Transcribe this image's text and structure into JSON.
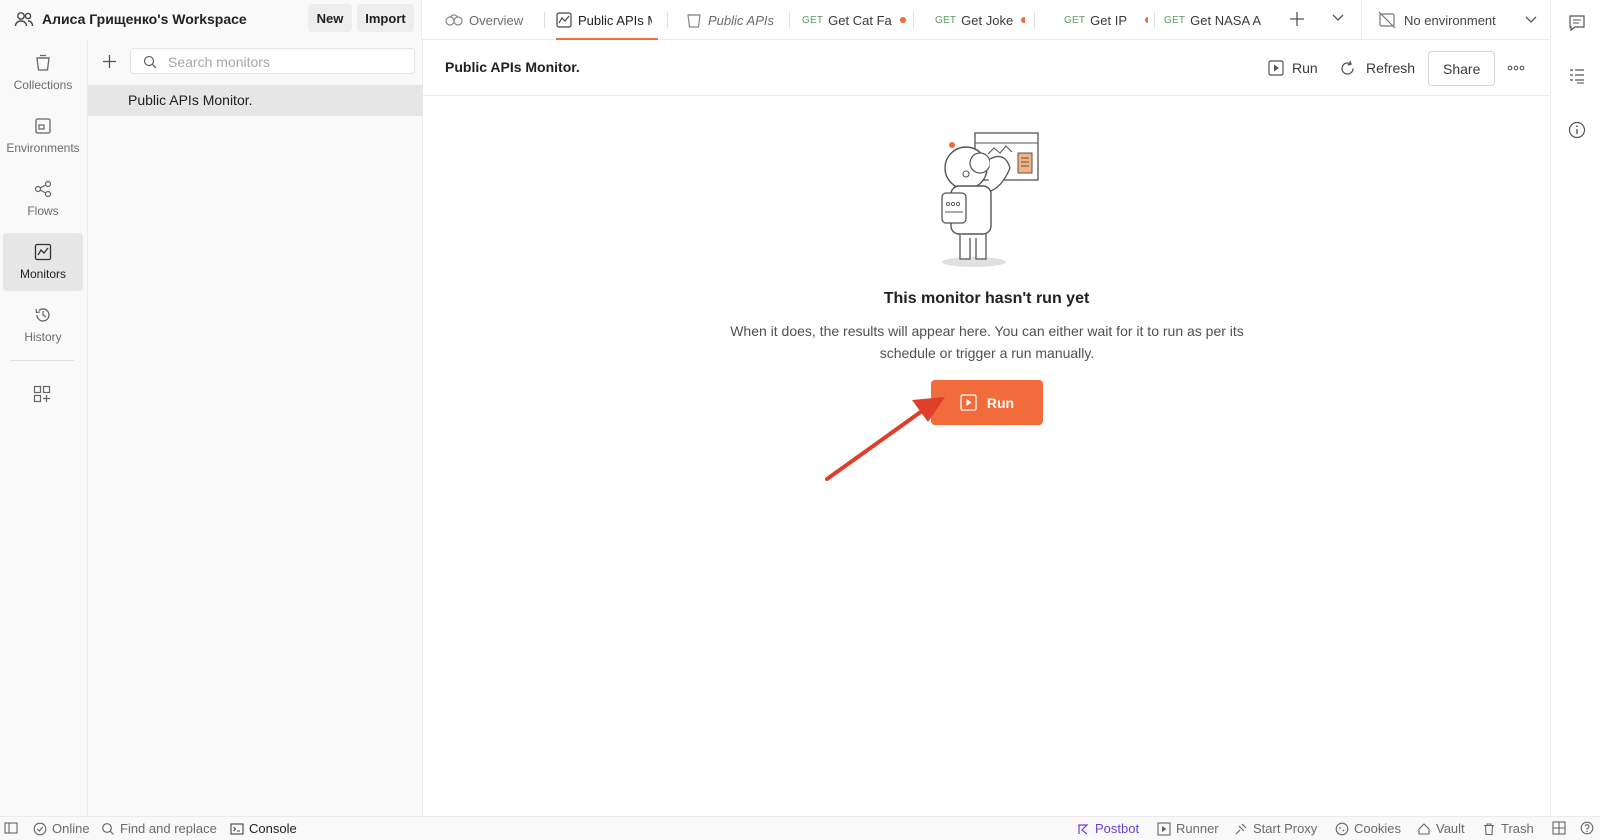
{
  "workspace": {
    "name": "Алиса Грищенко's Workspace",
    "new_label": "New",
    "import_label": "Import"
  },
  "tabs": [
    {
      "label": "Overview"
    },
    {
      "label": "Public APIs M"
    },
    {
      "label": "Public APIs"
    },
    {
      "method": "GET",
      "label": "Get Cat Fa"
    },
    {
      "method": "GET",
      "label": "Get Joke"
    },
    {
      "method": "GET",
      "label": "Get IP"
    },
    {
      "method": "GET",
      "label": "Get NASA A"
    }
  ],
  "environment": {
    "label": "No environment"
  },
  "nav": {
    "collections": "Collections",
    "environments": "Environments",
    "flows": "Flows",
    "monitors": "Monitors",
    "history": "History"
  },
  "sidebar": {
    "search_placeholder": "Search monitors",
    "items": [
      {
        "label": "Public APIs Monitor."
      }
    ]
  },
  "main": {
    "title": "Public APIs Monitor.",
    "run_label": "Run",
    "refresh_label": "Refresh",
    "share_label": "Share",
    "empty_title": "This monitor hasn't run yet",
    "empty_desc": "When it does, the results will appear here. You can either wait for it to run as per its schedule or trigger a run manually.",
    "run_button_label": "Run"
  },
  "statusbar": {
    "online": "Online",
    "find_replace": "Find and replace",
    "console": "Console",
    "postbot": "Postbot",
    "runner": "Runner",
    "start_proxy": "Start Proxy",
    "cookies": "Cookies",
    "vault": "Vault",
    "trash": "Trash"
  },
  "colors": {
    "accent": "#f26b3a",
    "postbot": "#6a3fd6",
    "method_get": "#5a9a5a",
    "annotation_arrow": "#e03e2a"
  }
}
